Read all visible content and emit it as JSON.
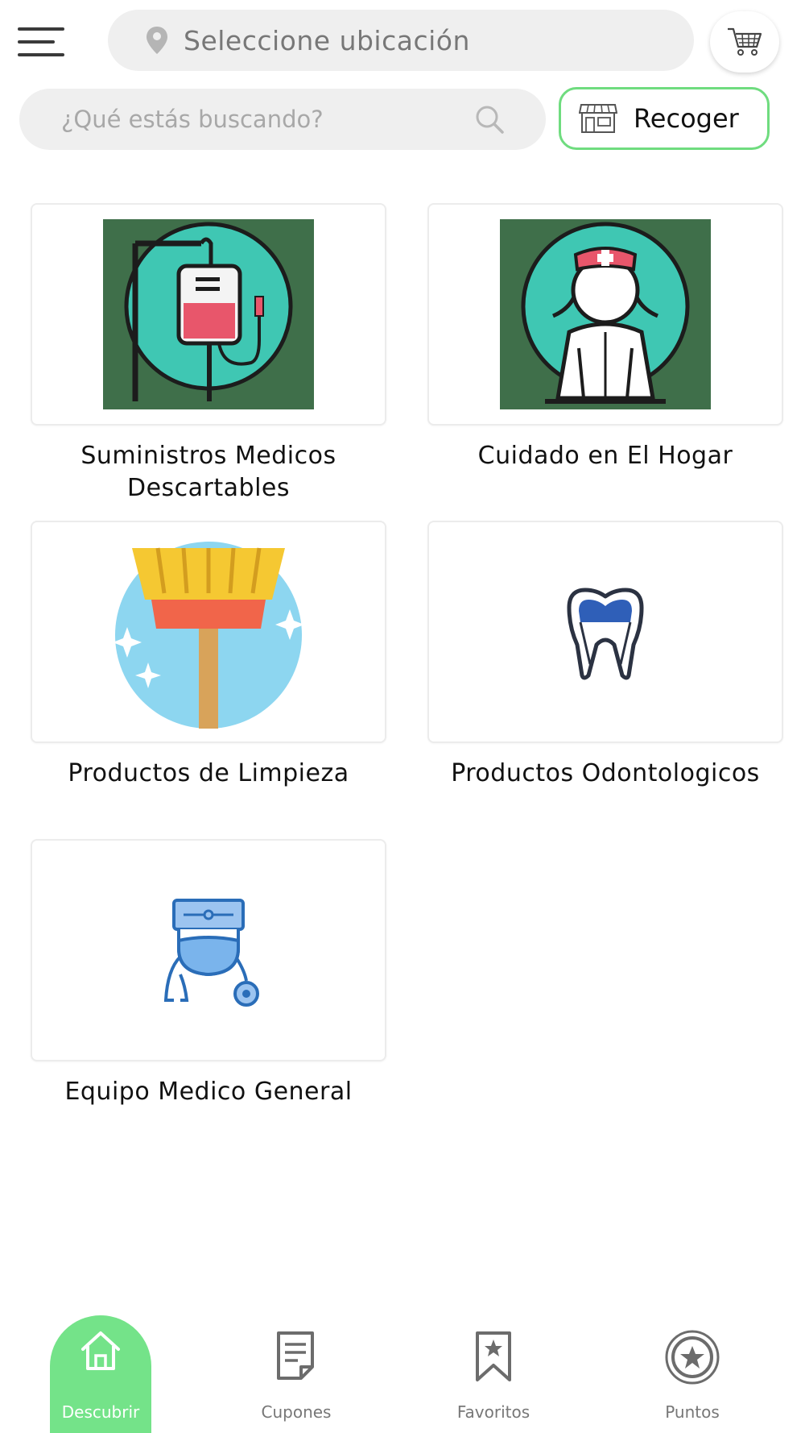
{
  "header": {
    "menu_icon": "hamburger-menu-icon",
    "location_placeholder": "Seleccione ubicación",
    "cart_icon": "shopping-cart-icon"
  },
  "search": {
    "placeholder": "¿Qué estás buscando?",
    "value": ""
  },
  "pickup": {
    "label": "Recoger",
    "icon": "storefront-icon",
    "accent_color": "#6fdc7f"
  },
  "categories": [
    {
      "name": "Suministros Medicos Descartables",
      "icon": "iv-bag-icon"
    },
    {
      "name": "Cuidado en El Hogar",
      "icon": "nurse-icon"
    },
    {
      "name": "Productos de Limpieza",
      "icon": "broom-icon"
    },
    {
      "name": "Productos Odontologicos",
      "icon": "tooth-icon"
    },
    {
      "name": "Equipo Medico General",
      "icon": "doctor-stethoscope-icon"
    }
  ],
  "bottom_nav": {
    "active_color": "#74e389",
    "items": [
      {
        "label": "Descubrir",
        "icon": "home-icon",
        "active": true
      },
      {
        "label": "Cupones",
        "icon": "coupon-document-icon",
        "active": false
      },
      {
        "label": "Favoritos",
        "icon": "bookmark-star-icon",
        "active": false
      },
      {
        "label": "Puntos",
        "icon": "star-badge-icon",
        "active": false
      }
    ]
  }
}
